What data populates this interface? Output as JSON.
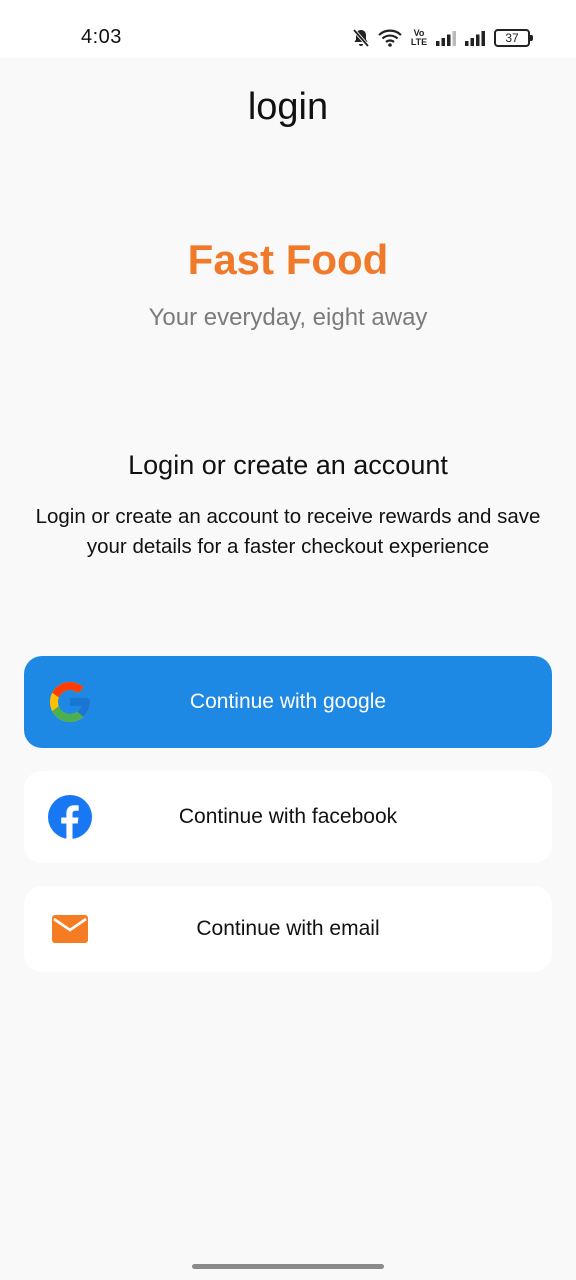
{
  "status_bar": {
    "time": "4:03",
    "volte": "Vo LTE",
    "battery": "37"
  },
  "header": {
    "title": "login"
  },
  "brand": {
    "name": "Fast Food",
    "tagline": "Your everyday, eight away",
    "color": "#f07a2a"
  },
  "section": {
    "heading": "Login or create an account",
    "description": "Login or create an account to receive rewards and save your details for a faster checkout experience"
  },
  "buttons": {
    "google": {
      "label": "Continue with google",
      "icon": "google-icon",
      "color": "#1e88e5"
    },
    "facebook": {
      "label": "Continue with facebook",
      "icon": "facebook-icon",
      "color": "#1877f2"
    },
    "email": {
      "label": "Continue with email",
      "icon": "email-icon",
      "color": "#f57c22"
    }
  }
}
